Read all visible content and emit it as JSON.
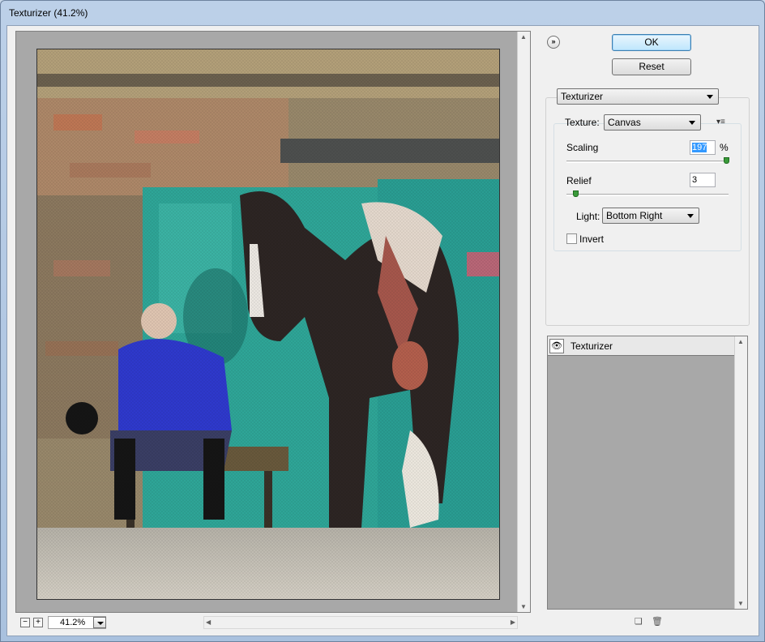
{
  "window": {
    "title": "Texturizer (41.2%)"
  },
  "preview": {
    "zoom_value": "41.2%",
    "zoom_out_label": "−",
    "zoom_in_label": "+",
    "image_description": "painting-preview"
  },
  "actions": {
    "ok_label": "OK",
    "reset_label": "Reset",
    "collapse_icon": "»"
  },
  "filter": {
    "selected": "Texturizer",
    "texture_label": "Texture:",
    "texture_value": "Canvas",
    "scaling_label": "Scaling",
    "scaling_value": "197",
    "scaling_unit": "%",
    "scaling_fraction": 0.99,
    "relief_label": "Relief",
    "relief_value": "3",
    "relief_fraction": 0.06,
    "light_label": "Light:",
    "light_value": "Bottom Right",
    "invert_label": "Invert",
    "invert_checked": false,
    "texture_menu_icon": "▾≡"
  },
  "layers": {
    "items": [
      {
        "label": "Texturizer",
        "visible_icon": "👁"
      }
    ],
    "new_icon": "❏",
    "delete_icon": "🗑"
  }
}
